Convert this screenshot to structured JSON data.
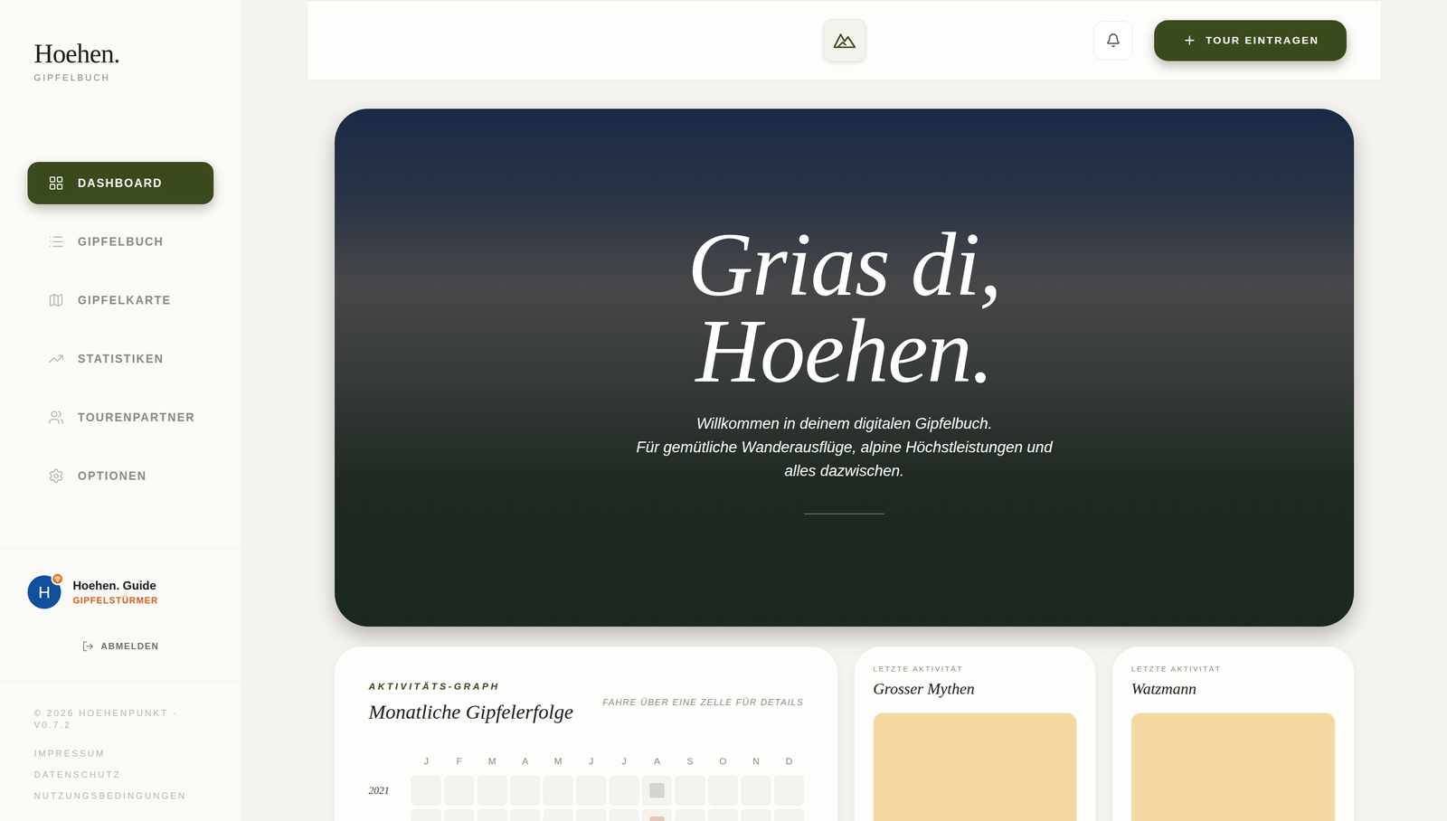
{
  "brand": {
    "name": "Hoehen.",
    "tagline": "GIPFELBUCH"
  },
  "nav": [
    {
      "label": "DASHBOARD",
      "selected": true
    },
    {
      "label": "GIPFELBUCH",
      "selected": false
    },
    {
      "label": "GIPFELKARTE",
      "selected": false
    },
    {
      "label": "STATISTIKEN",
      "selected": false
    },
    {
      "label": "TOURENPARTNER",
      "selected": false
    },
    {
      "label": "OPTIONEN",
      "selected": false
    }
  ],
  "user": {
    "initial": "H",
    "name": "Hoehen. Guide",
    "rank": "GIPFELSTÜRMER",
    "logout": "ABMELDEN"
  },
  "footer": {
    "copyright": "© 2026 HOEHENPUNKT · V0.7.2",
    "links": [
      "IMPRESSUM",
      "DATENSCHUTZ",
      "NUTZUNGSBEDINGUNGEN"
    ]
  },
  "header": {
    "action": "TOUR EINTRAGEN"
  },
  "hero": {
    "title_lines": [
      "Grias di,",
      "Hoehen."
    ],
    "text_lines": [
      "Willkommen in deinem digitalen Gipfelbuch.",
      "Für gemütliche Wanderausflüge, alpine Höchstleistungen und",
      "alles dazwischen."
    ]
  },
  "activity": {
    "eyebrow": "AKTIVITÄTS-GRAPH",
    "title": "Monatliche Gipfelerfolge",
    "hint": "FAHRE ÜBER EINE ZELLE FÜR DETAILS",
    "months": [
      "J",
      "F",
      "M",
      "A",
      "M",
      "J",
      "J",
      "A",
      "S",
      "O",
      "N",
      "D"
    ],
    "rows": [
      {
        "year": "2021",
        "values": [
          0,
          0,
          0,
          0,
          0,
          0,
          0,
          1,
          0,
          0,
          0,
          0
        ]
      },
      {
        "year": "",
        "values": [
          0,
          0,
          0,
          0,
          0,
          0,
          0,
          2,
          0,
          0,
          0,
          0
        ]
      }
    ]
  },
  "recent": [
    {
      "eyebrow": "LETZTE AKTIVITÄT",
      "title": "Grosser Mythen"
    },
    {
      "eyebrow": "LETZTE AKTIVITÄT",
      "title": "Watzmann"
    }
  ]
}
